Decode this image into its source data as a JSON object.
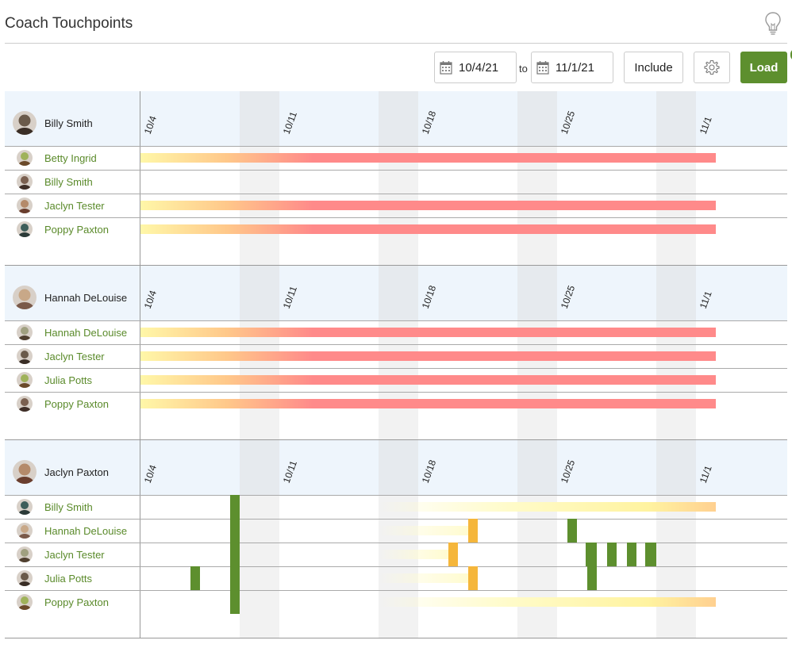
{
  "page": {
    "title": "Coach Touchpoints"
  },
  "toolbar": {
    "date_from": "10/4/21",
    "to_label": "to",
    "date_to": "11/1/21",
    "include_label": "Include",
    "load_label": "Load"
  },
  "ticks": [
    "10/4",
    "10/11",
    "10/18",
    "10/25",
    "11/1"
  ],
  "colors": {
    "accent": "#5d8f2e",
    "member_name": "#5a8a2a",
    "overdue_red": "#ff8a8a",
    "fade_yellow": "#fff7a8",
    "touchpoint_green": "#5d8f2e",
    "touchpoint_orange": "#f5b63b"
  },
  "groups": [
    {
      "coach": "Billy Smith",
      "members": [
        {
          "name": "Betty Ingrid",
          "status": "overdue"
        },
        {
          "name": "Billy Smith",
          "status": "none"
        },
        {
          "name": "Jaclyn Tester",
          "status": "overdue"
        },
        {
          "name": "Poppy Paxton",
          "status": "overdue"
        }
      ]
    },
    {
      "coach": "Hannah DeLouise",
      "members": [
        {
          "name": "Hannah DeLouise",
          "status": "overdue"
        },
        {
          "name": "Jaclyn Tester",
          "status": "overdue"
        },
        {
          "name": "Julia Potts",
          "status": "overdue"
        },
        {
          "name": "Poppy Paxton",
          "status": "overdue"
        }
      ]
    },
    {
      "coach": "Jaclyn Paxton",
      "members": [
        {
          "name": "Billy Smith",
          "status": "recent"
        },
        {
          "name": "Hannah DeLouise",
          "status": "recent"
        },
        {
          "name": "Jaclyn Tester",
          "status": "recent"
        },
        {
          "name": "Julia Potts",
          "status": "recent"
        },
        {
          "name": "Poppy Paxton",
          "status": "recent"
        }
      ]
    }
  ]
}
